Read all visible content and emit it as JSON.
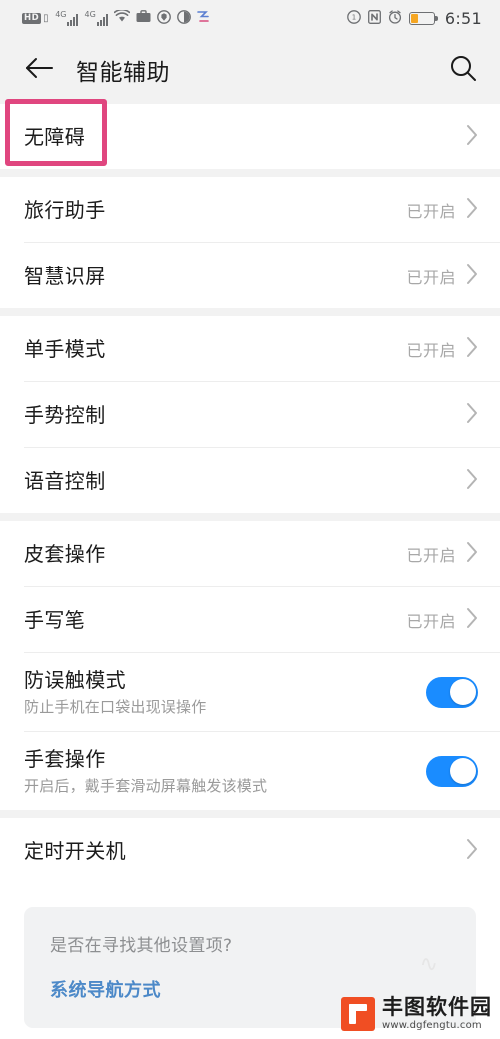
{
  "status_bar": {
    "icons_left": [
      "hd-voice-icon",
      "signal-4g-1-icon",
      "signal-4g-2-icon",
      "wifi-icon",
      "briefcase-icon",
      "shield-icon",
      "contrast-icon",
      "zoom-app-icon"
    ],
    "hd_label": "HD",
    "network_label_1": "4G",
    "network_label_2": "4G",
    "icons_right": [
      "screen-record-icon",
      "nfc-icon",
      "alarm-icon",
      "battery-icon"
    ],
    "nfc_label": "N",
    "time": "6:51"
  },
  "app_bar": {
    "back_label": "back-arrow",
    "title": "智能辅助",
    "search_label": "search-icon"
  },
  "sections": [
    {
      "rows": [
        {
          "title": "无障碍",
          "value": "",
          "type": "link",
          "highlighted": true
        }
      ]
    },
    {
      "rows": [
        {
          "title": "旅行助手",
          "value": "已开启",
          "type": "link"
        },
        {
          "title": "智慧识屏",
          "value": "已开启",
          "type": "link"
        }
      ]
    },
    {
      "rows": [
        {
          "title": "单手模式",
          "value": "已开启",
          "type": "link"
        },
        {
          "title": "手势控制",
          "value": "",
          "type": "link"
        },
        {
          "title": "语音控制",
          "value": "",
          "type": "link"
        }
      ]
    },
    {
      "rows": [
        {
          "title": "皮套操作",
          "value": "已开启",
          "type": "link"
        },
        {
          "title": "手写笔",
          "value": "已开启",
          "type": "link"
        },
        {
          "title": "防误触模式",
          "subtitle": "防止手机在口袋出现误操作",
          "type": "toggle",
          "toggle_on": true
        },
        {
          "title": "手套操作",
          "subtitle": "开启后，戴手套滑动屏幕触发该模式",
          "type": "toggle",
          "toggle_on": true
        }
      ]
    },
    {
      "rows": [
        {
          "title": "定时开关机",
          "value": "",
          "type": "link"
        }
      ]
    }
  ],
  "footer": {
    "question": "是否在寻找其他设置项?",
    "link": "系统导航方式"
  },
  "watermark": {
    "name": "丰图软件园",
    "url": "www.dgfengtu.com"
  },
  "colors": {
    "accent_toggle": "#1a8cff",
    "highlight_border": "#e0467f",
    "link": "#4c89c8",
    "battery": "#f5a623"
  }
}
